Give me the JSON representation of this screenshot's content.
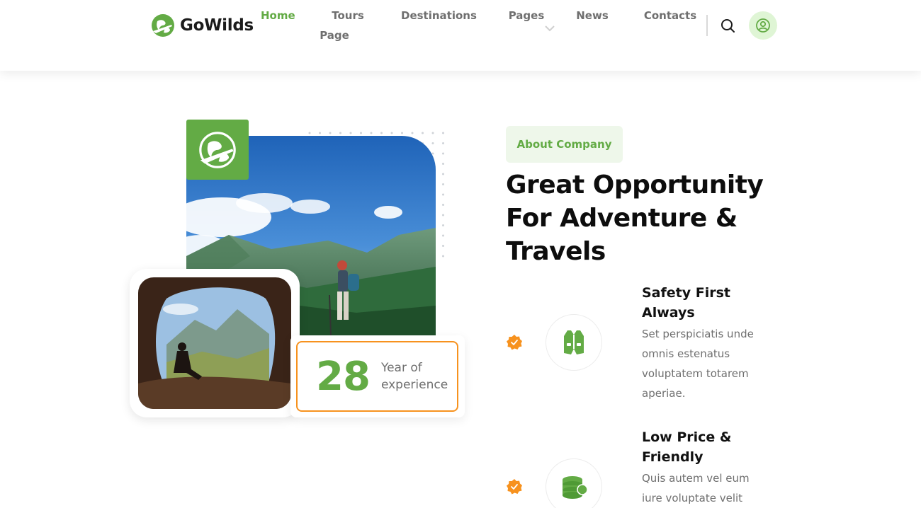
{
  "brand": {
    "name": "GoWilds",
    "accent": "#63ab45",
    "orange": "#f7921e"
  },
  "nav": {
    "items": [
      {
        "label": "Home",
        "active": true
      },
      {
        "label": "Tours"
      },
      {
        "label": "Page"
      },
      {
        "label": "Destinations"
      },
      {
        "label": "Pages"
      },
      {
        "label": "News"
      },
      {
        "label": "Contacts"
      }
    ],
    "icons": {
      "search": "search-icon",
      "user": "user-circle-icon",
      "dropdown": "chevron-down-icon"
    }
  },
  "about": {
    "tag": "About Company",
    "headline": "Great Opportunity For Adventure & Travels",
    "experience": {
      "number": "28",
      "label": "Year of experience"
    },
    "features": [
      {
        "title": "Safety First Always",
        "text": "Set perspiciatis unde omnis estenatus voluptatem totarem aperiae.",
        "icon": "vest-icon"
      },
      {
        "title": "Low Price & Friendly",
        "text": "Quis autem vel eum iure voluptate velit",
        "icon": "coins-icon"
      }
    ]
  }
}
